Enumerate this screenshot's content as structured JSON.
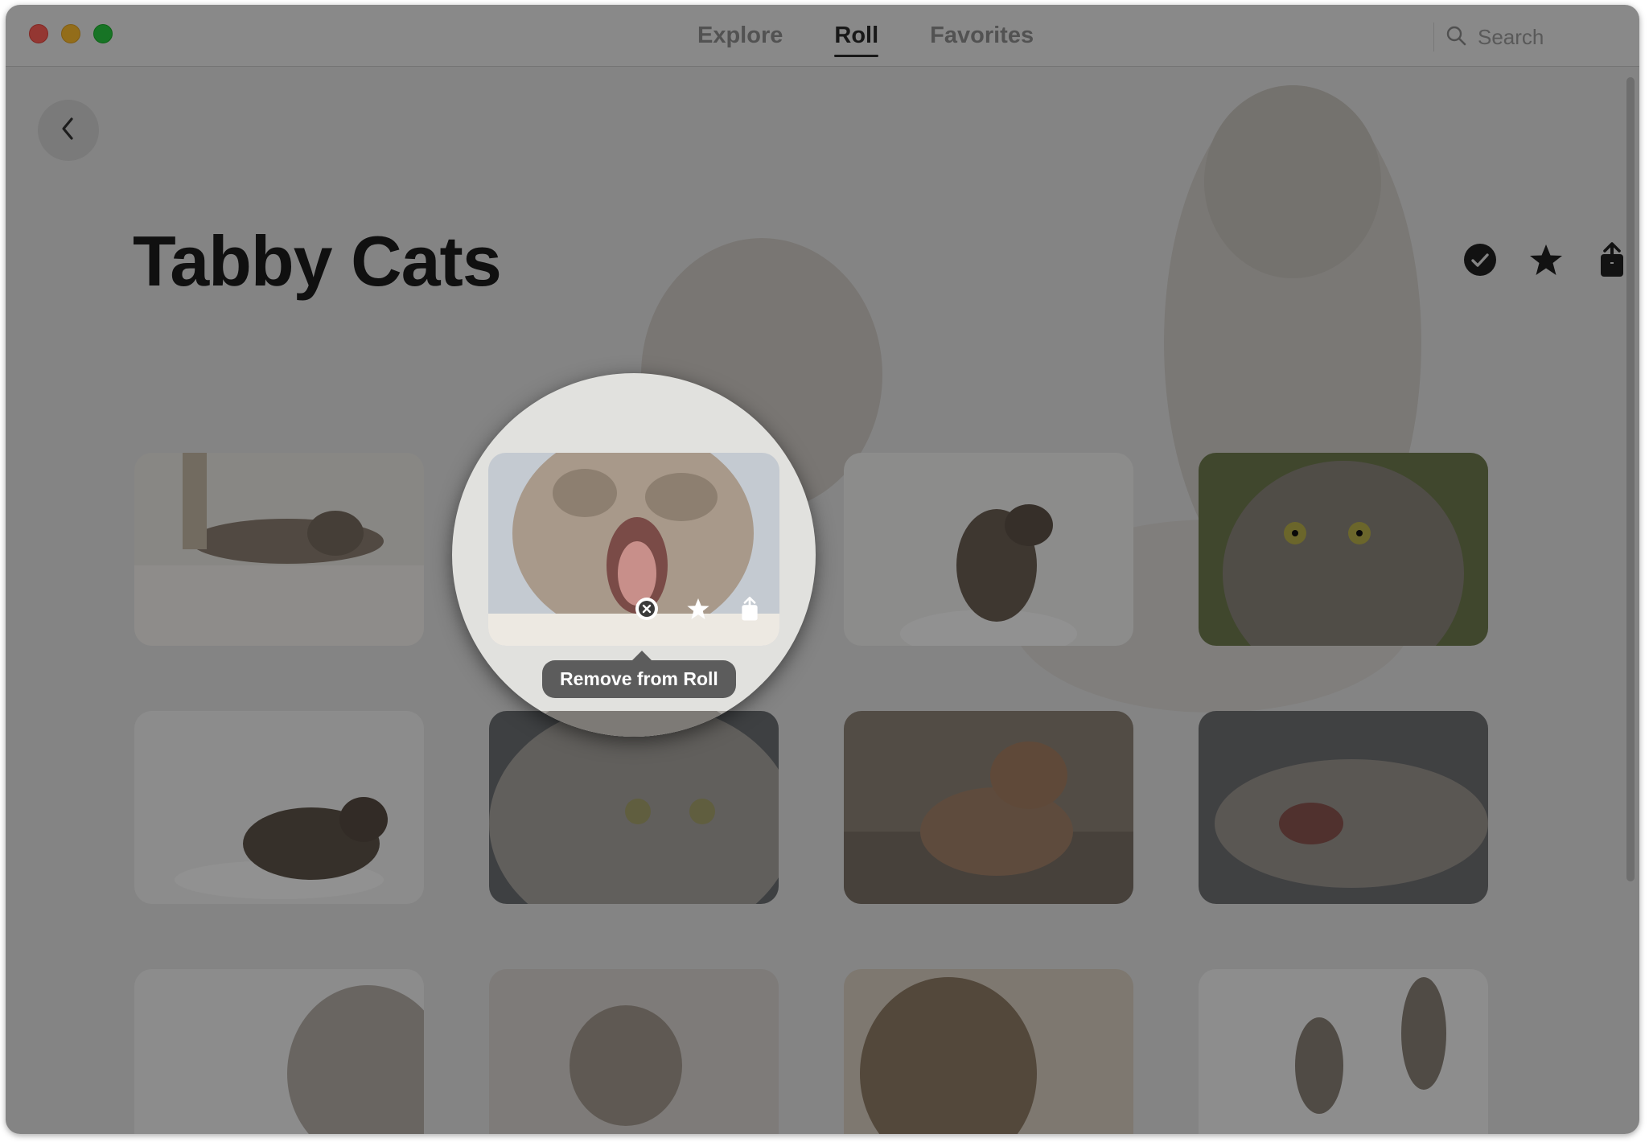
{
  "window": {
    "nav_tabs": [
      {
        "label": "Explore",
        "active": false
      },
      {
        "label": "Roll",
        "active": true
      },
      {
        "label": "Favorites",
        "active": false
      }
    ],
    "search": {
      "placeholder": "Search",
      "icon": "search-icon"
    }
  },
  "page": {
    "back_icon": "chevron-left-icon",
    "title": "Tabby Cats",
    "header_actions": [
      "checkmark-circle-icon",
      "star-icon",
      "share-icon"
    ]
  },
  "magnifier": {
    "actions": [
      "remove-circle-icon",
      "star-icon",
      "share-icon"
    ],
    "tooltip": "Remove from Roll"
  },
  "grid": {
    "photos": [
      "cat-lying-on-blanket",
      "kitten-yawning",
      "kitten-on-chair",
      "tabby-face-closeup",
      "cat-on-white-chair",
      "silver-tabby-portrait",
      "kitten-lying-on-floor",
      "cat-yawning-lying",
      "cat-profile",
      "fluffy-kitten",
      "tabby-kitten-looking-up",
      "two-kittens-jumping"
    ]
  },
  "colors": {
    "close": "#ff5f57",
    "minimize": "#febc2e",
    "zoom": "#28c840",
    "overlay": "rgba(0,0,0,0.42)",
    "tooltip_bg": "#5c5c5c"
  }
}
